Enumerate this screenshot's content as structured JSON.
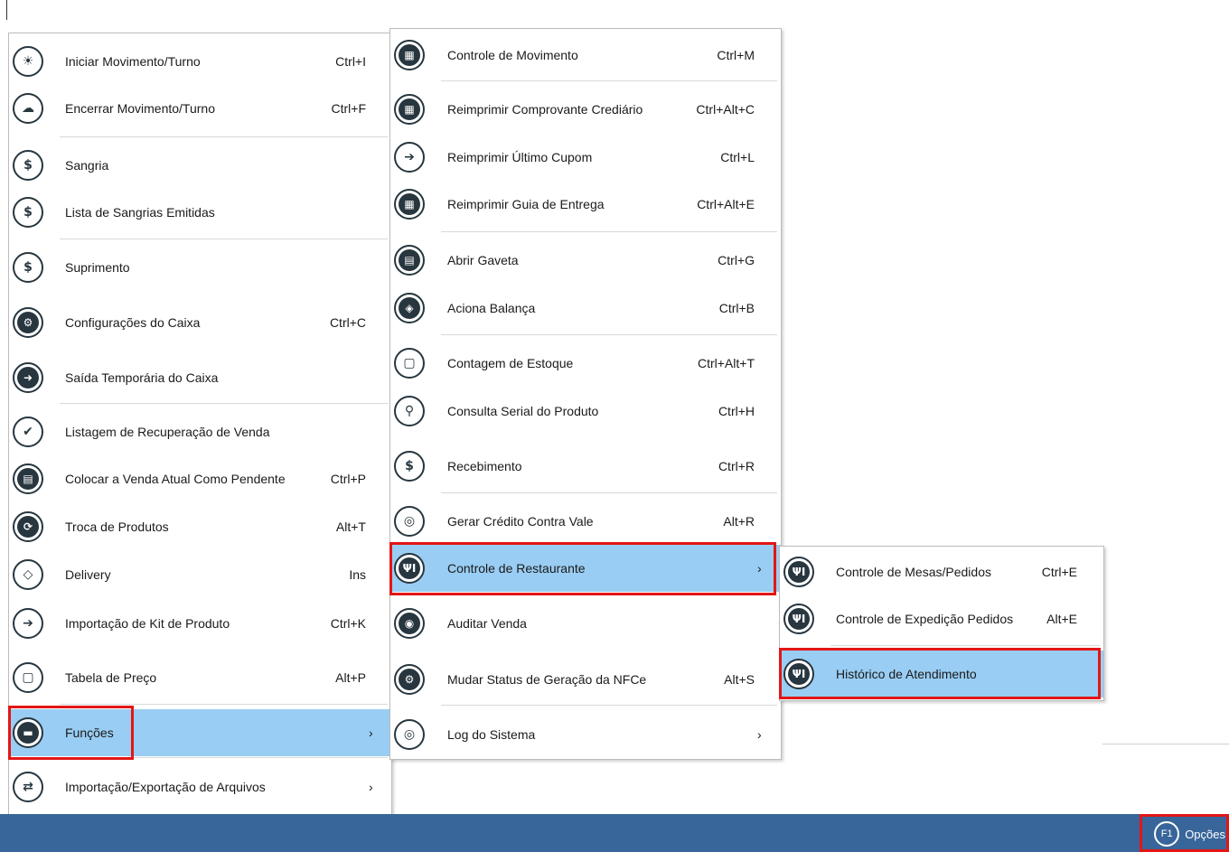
{
  "menu1": {
    "items": [
      {
        "label": "Iniciar Movimento/Turno",
        "shortcut": "Ctrl+I",
        "icon": "sun-icon"
      },
      {
        "label": "Encerrar Movimento/Turno",
        "shortcut": "Ctrl+F",
        "icon": "cloud-sun-icon"
      },
      {
        "label": "Sangria",
        "shortcut": "",
        "icon": "money-minus-icon"
      },
      {
        "label": "Lista de Sangrias Emitidas",
        "shortcut": "",
        "icon": "money-minus-icon"
      },
      {
        "label": "Suprimento",
        "shortcut": "",
        "icon": "money-plus-icon"
      },
      {
        "label": "Configurações do Caixa",
        "shortcut": "Ctrl+C",
        "icon": "gear-icon"
      },
      {
        "label": "Saída Temporária do Caixa",
        "shortcut": "",
        "icon": "exit-icon"
      },
      {
        "label": "Listagem de Recuperação de Venda",
        "shortcut": "",
        "icon": "checklist-icon"
      },
      {
        "label": "Colocar a Venda Atual Como Pendente",
        "shortcut": "Ctrl+P",
        "icon": "register-icon"
      },
      {
        "label": "Troca de Produtos",
        "shortcut": "Alt+T",
        "icon": "swap-icon"
      },
      {
        "label": "Delivery",
        "shortcut": "Ins",
        "icon": "delivery-icon"
      },
      {
        "label": "Importação de Kit de Produto",
        "shortcut": "Ctrl+K",
        "icon": "import-icon"
      },
      {
        "label": "Tabela de Preço",
        "shortcut": "Alt+P",
        "icon": "clipboard-icon"
      },
      {
        "label": "Funções",
        "shortcut": "",
        "icon": "cart-icon",
        "submenu_arrow": "›"
      },
      {
        "label": "Importação/Exportação de Arquivos",
        "shortcut": "",
        "icon": "shuffle-icon",
        "submenu_arrow": "›"
      }
    ]
  },
  "menu2": {
    "items": [
      {
        "label": "Controle de Movimento",
        "shortcut": "Ctrl+M",
        "icon": "calculator-icon"
      },
      {
        "label": "Reimprimir Comprovante Crediário",
        "shortcut": "Ctrl+Alt+C",
        "icon": "calculator-icon"
      },
      {
        "label": "Reimprimir Último Cupom",
        "shortcut": "Ctrl+L",
        "icon": "import-icon"
      },
      {
        "label": "Reimprimir Guia de Entrega",
        "shortcut": "Ctrl+Alt+E",
        "icon": "calculator-icon"
      },
      {
        "label": "Abrir Gaveta",
        "shortcut": "Ctrl+G",
        "icon": "register-icon"
      },
      {
        "label": "Aciona Balança",
        "shortcut": "Ctrl+B",
        "icon": "layers-icon"
      },
      {
        "label": "Contagem de Estoque",
        "shortcut": "Ctrl+Alt+T",
        "icon": "clipboard-icon"
      },
      {
        "label": "Consulta Serial do Produto",
        "shortcut": "Ctrl+H",
        "icon": "search-icon"
      },
      {
        "label": "Recebimento",
        "shortcut": "Ctrl+R",
        "icon": "money-plus-icon"
      },
      {
        "label": "Gerar Crédito Contra Vale",
        "shortcut": "Alt+R",
        "icon": "voucher-icon"
      },
      {
        "label": "Controle de Restaurante",
        "shortcut": "",
        "icon": "fork-knife-icon",
        "submenu_arrow": "›"
      },
      {
        "label": "Auditar Venda",
        "shortcut": "",
        "icon": "audit-icon"
      },
      {
        "label": "Mudar Status de Geração da NFCe",
        "shortcut": "Alt+S",
        "icon": "gear-icon"
      },
      {
        "label": "Log do Sistema",
        "shortcut": "",
        "icon": "voucher-icon",
        "submenu_arrow": "›"
      }
    ]
  },
  "menu3": {
    "items": [
      {
        "label": "Controle de Mesas/Pedidos",
        "shortcut": "Ctrl+E",
        "icon": "fork-knife-icon"
      },
      {
        "label": "Controle de Expedição Pedidos",
        "shortcut": "Alt+E",
        "icon": "fork-knife-icon"
      },
      {
        "label": "Histórico de Atendimento",
        "shortcut": "",
        "icon": "fork-knife-icon"
      }
    ]
  },
  "statusbar": {
    "badge": "F1",
    "label": "Opções",
    "color": "#38669a"
  },
  "colors": {
    "highlight": "#99cdf3",
    "annotation": "#e31616",
    "icon": "#27363f"
  }
}
